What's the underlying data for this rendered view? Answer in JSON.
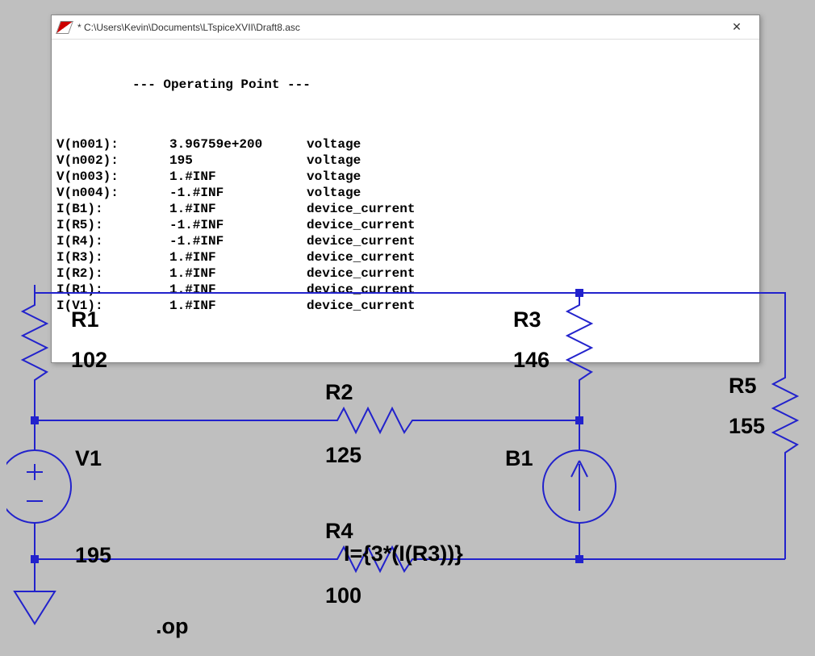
{
  "window": {
    "title": "* C:\\Users\\Kevin\\Documents\\LTspiceXVII\\Draft8.asc",
    "close": "✕"
  },
  "output": {
    "header": "--- Operating Point ---",
    "rows": [
      {
        "name": "V(n001):",
        "value": "3.96759e+200",
        "type": "voltage"
      },
      {
        "name": "V(n002):",
        "value": "195",
        "type": "voltage"
      },
      {
        "name": "V(n003):",
        "value": "1.#INF",
        "type": "voltage"
      },
      {
        "name": "V(n004):",
        "value": "-1.#INF",
        "type": "voltage"
      },
      {
        "name": "I(B1):",
        "value": "1.#INF",
        "type": "device_current"
      },
      {
        "name": "I(R5):",
        "value": "-1.#INF",
        "type": "device_current"
      },
      {
        "name": "I(R4):",
        "value": "-1.#INF",
        "type": "device_current"
      },
      {
        "name": "I(R3):",
        "value": "1.#INF",
        "type": "device_current"
      },
      {
        "name": "I(R2):",
        "value": "1.#INF",
        "type": "device_current"
      },
      {
        "name": "I(R1):",
        "value": "1.#INF",
        "type": "device_current"
      },
      {
        "name": "I(V1):",
        "value": "1.#INF",
        "type": "device_current"
      }
    ]
  },
  "schematic": {
    "directive": ".op",
    "components": {
      "R1": {
        "name": "R1",
        "value": "102"
      },
      "R2": {
        "name": "R2",
        "value": "125"
      },
      "R3": {
        "name": "R3",
        "value": "146"
      },
      "R4": {
        "name": "R4",
        "value": "100"
      },
      "R5": {
        "name": "R5",
        "value": "155"
      },
      "V1": {
        "name": "V1",
        "value": "195"
      },
      "B1": {
        "name": "B1",
        "value": "I={3*(I(R3))}"
      }
    }
  }
}
